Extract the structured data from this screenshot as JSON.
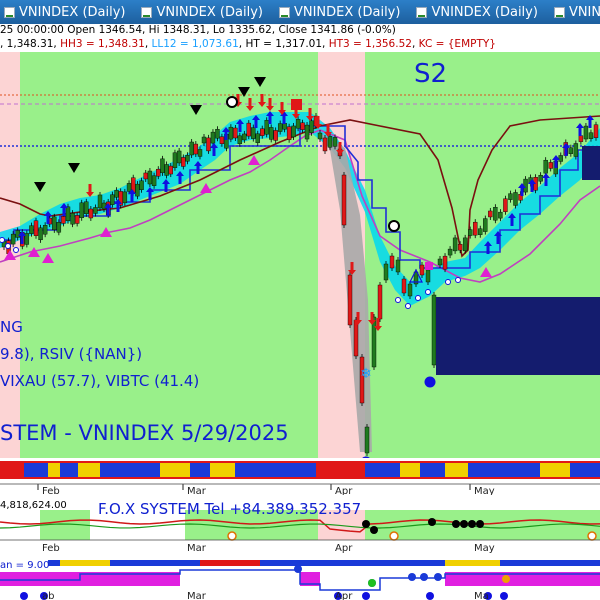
{
  "tabs": [
    {
      "label": "VNINDEX (Daily)"
    },
    {
      "label": "VNINDEX (Daily)"
    },
    {
      "label": "VNINDEX (Daily)"
    },
    {
      "label": "VNINDEX (Daily)"
    },
    {
      "label": "VNINDEX (Daily)"
    }
  ],
  "info": {
    "line1": "25 00:00:00 Open 1346.54, Hi 1348.31, Lo 1335.62, Close 1341.86 (-0.0%)",
    "line2_prefix": ", 1,348.31, ",
    "hh3": "HH3 = 1,348.31",
    "ll12": "LL12 = 1,073.61",
    "ht": "HT = 1,317.01",
    "ht3": "HT3 = 1,356.52",
    "kc": "KC = {EMPTY}"
  },
  "overlay": {
    "s2": "S2",
    "ng": "NG",
    "rsiv": "9.8), RSIV ({NAN})",
    "vixau": "VIXAU (57.7), VIBTC (41.4)",
    "system": "STEM - VNINDEX 5/29/2025"
  },
  "months_main": [
    "Feb",
    "Mar",
    "Apr",
    "May"
  ],
  "panel2": {
    "value": "4,818,624.00",
    "title": "F.O.X SYSTEM Tel +84.389.352.357",
    "months": [
      "Feb",
      "Mar",
      "Apr",
      "May"
    ]
  },
  "panel3": {
    "label": "an = 9.00",
    "months": [
      "ab",
      "Mar",
      "Apr",
      "Ma"
    ]
  },
  "colors": {
    "bullish_bg": "#99f08a",
    "bearish_bg": "#fcd4d4",
    "candle_up": "#1f7a1f",
    "candle_down": "#e01818",
    "ribbon": "#00d8f0",
    "magenta_line": "#c040c0",
    "blue_line": "#1f2fd8",
    "brown_line": "#7a1010",
    "navy_box": "#141c6e",
    "text_blue": "#1020d0"
  },
  "chart_data": {
    "type": "candlestick",
    "title": "VNINDEX (Daily)",
    "ohlc_last": {
      "open": 1346.54,
      "high": 1348.31,
      "low": 1335.62,
      "close": 1341.86,
      "change_pct": -0.0
    },
    "levels": {
      "HH3": 1348.31,
      "LL12": 1073.61,
      "HT": 1317.01,
      "HT3": 1356.52
    },
    "x_labels": [
      "Feb",
      "Mar",
      "Apr",
      "May"
    ]
  }
}
